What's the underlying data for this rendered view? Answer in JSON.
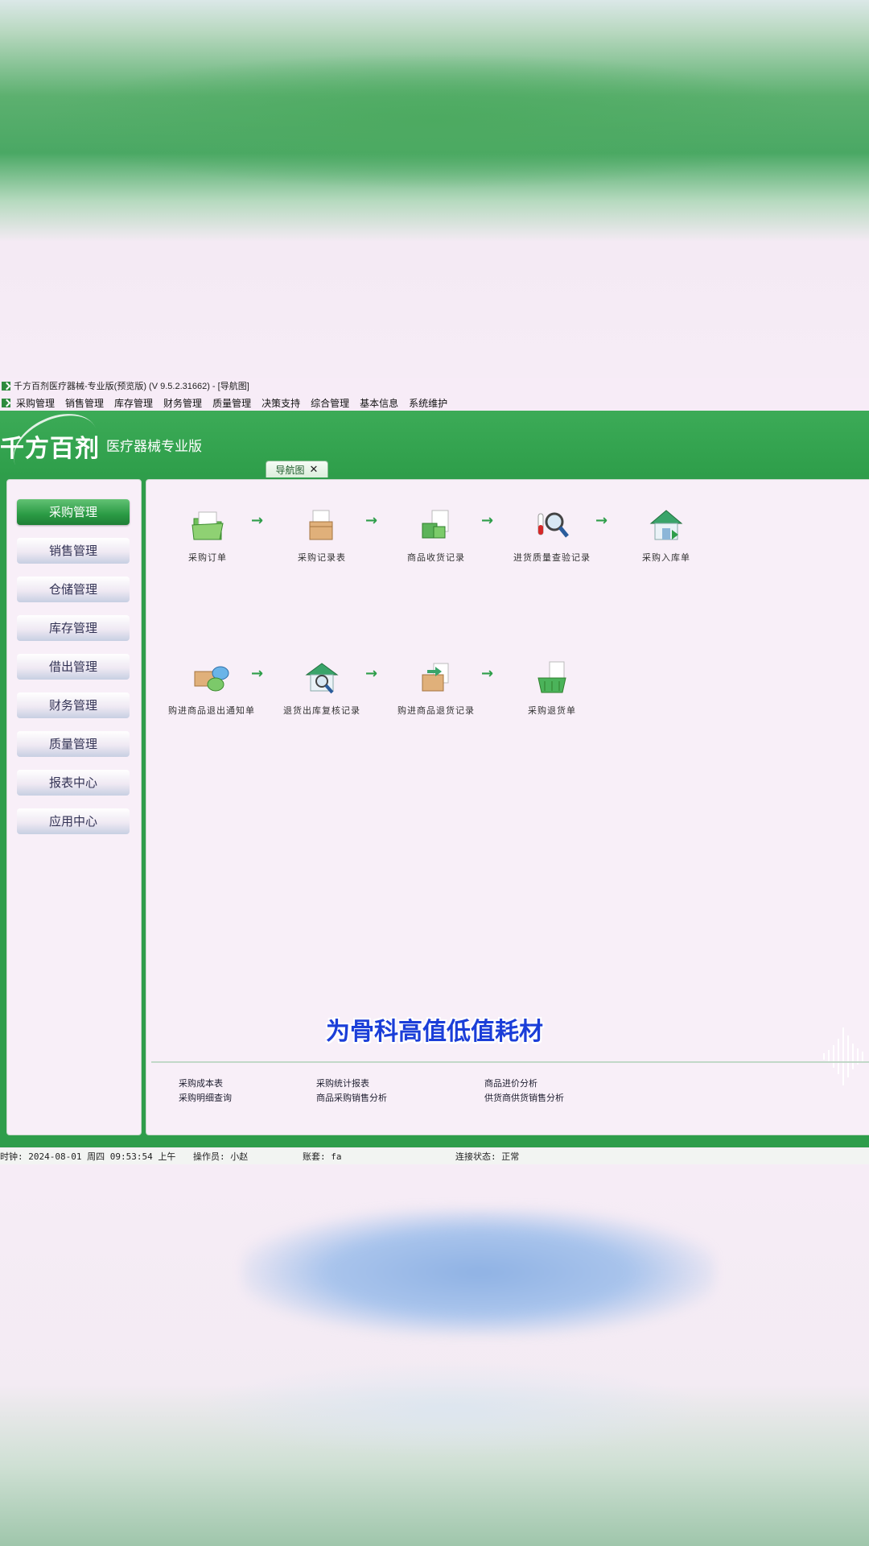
{
  "window": {
    "title": "千方百剂医疗器械-专业版(预览版) (V 9.5.2.31662)  - [导航图]"
  },
  "menu": [
    "采购管理",
    "销售管理",
    "库存管理",
    "财务管理",
    "质量管理",
    "决策支持",
    "综合管理",
    "基本信息",
    "系统维护"
  ],
  "banner": {
    "logo": "千方百剂",
    "product": "医疗器械专业版"
  },
  "tab": {
    "label": "导航图",
    "close": "✕"
  },
  "sidebar": {
    "items": [
      {
        "label": "采购管理",
        "active": true
      },
      {
        "label": "销售管理"
      },
      {
        "label": "仓储管理"
      },
      {
        "label": "库存管理"
      },
      {
        "label": "借出管理"
      },
      {
        "label": "财务管理"
      },
      {
        "label": "质量管理"
      },
      {
        "label": "报表中心"
      },
      {
        "label": "应用中心"
      }
    ]
  },
  "flow_row1": [
    {
      "label": "采购订单",
      "icon": "folder-icon"
    },
    {
      "label": "采购记录表",
      "icon": "box-icon"
    },
    {
      "label": "商品收货记录",
      "icon": "receive-goods-icon"
    },
    {
      "label": "进货质量查验记录",
      "icon": "magnifier-icon"
    },
    {
      "label": "采购入库单",
      "icon": "warehouse-icon"
    }
  ],
  "flow_row2": [
    {
      "label": "购进商品退出通知单",
      "icon": "notify-icon"
    },
    {
      "label": "退货出库复核记录",
      "icon": "review-icon"
    },
    {
      "label": "购进商品退货记录",
      "icon": "return-box-icon"
    },
    {
      "label": "采购退货单",
      "icon": "basket-icon"
    }
  ],
  "arrow": "→",
  "reports": {
    "col1": [
      "采购成本表",
      "采购明细查询"
    ],
    "col2": [
      "采购统计报表",
      "商品采购销售分析"
    ],
    "col3": [
      "商品进价分析",
      "供货商供货销售分析"
    ]
  },
  "subtitle": "为骨科高值低值耗材",
  "status": {
    "clock": "时钟: 2024-08-01 周四 09:53:54 上午",
    "operator": "操作员: 小赵",
    "account": "账套: fa",
    "connection": "连接状态: 正常"
  },
  "colors": {
    "brand_green": "#2e9e4a",
    "subtitle_blue": "#1b3ed8"
  }
}
